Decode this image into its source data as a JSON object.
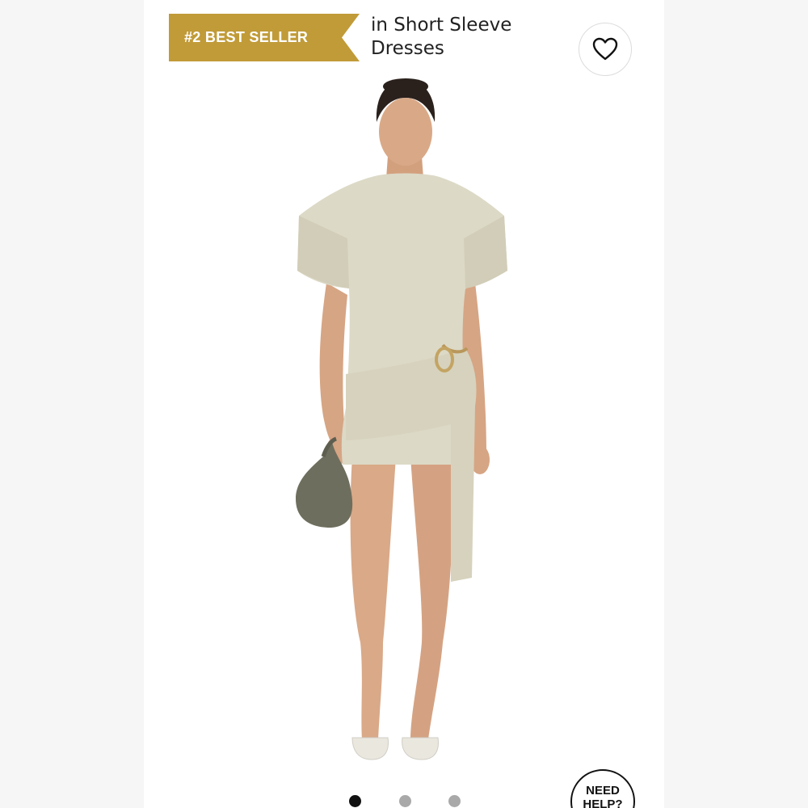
{
  "badge": {
    "label": "#2 BEST SELLER",
    "color": "#c19b38"
  },
  "category": {
    "text": "in Short Sleeve Dresses"
  },
  "favorite": {
    "icon": "heart-icon"
  },
  "carousel": {
    "total_slides": 3,
    "active_index": 0
  },
  "help_button": {
    "label": "NEED HELP?"
  }
}
